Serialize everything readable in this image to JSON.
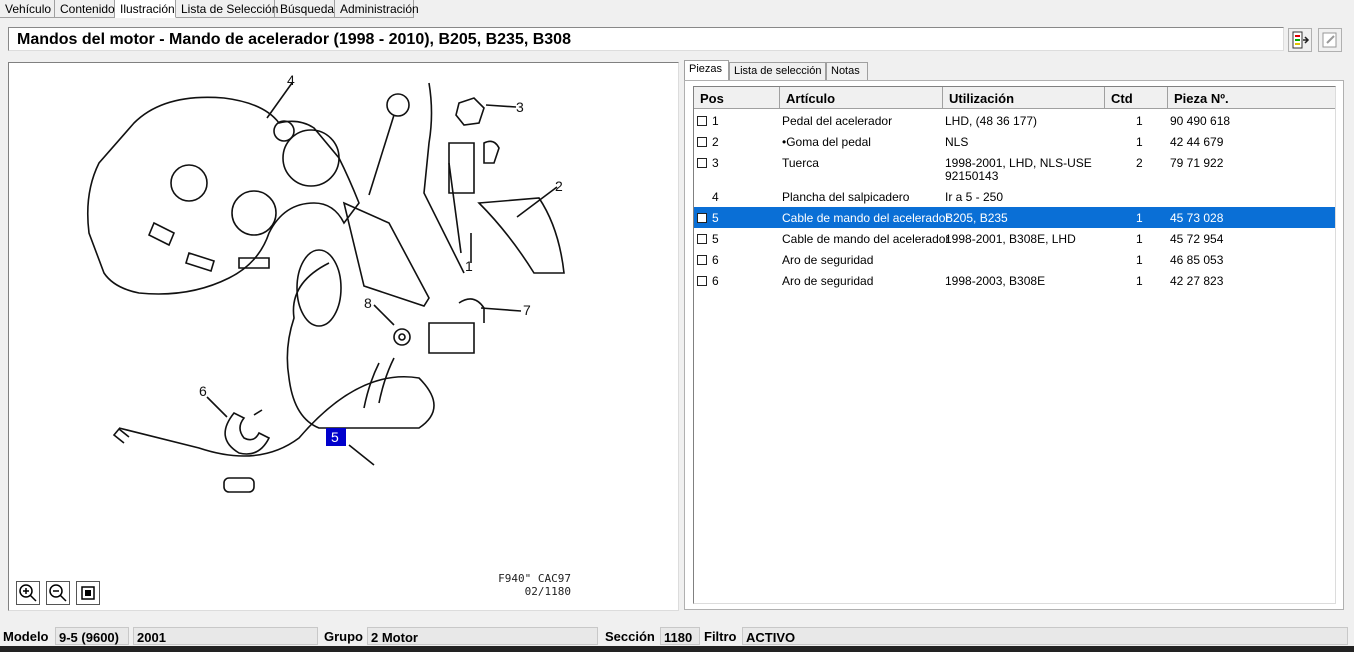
{
  "tabs": [
    "Vehículo",
    "Contenido",
    "Ilustración",
    "Lista de Selección",
    "Búsqueda",
    "Administración"
  ],
  "active_tab": "Ilustración",
  "title": "Mandos del motor - Mando de acelerador   (1998 - 2010), B205, B235, B308",
  "illustration": {
    "callouts": [
      "4",
      "3",
      "2",
      "1",
      "8",
      "7",
      "6",
      "5"
    ],
    "highlighted_callout": "5",
    "stamp_line1": "F940\" CAC97",
    "stamp_line2": "02/1180"
  },
  "right_tabs": [
    "Piezas",
    "Lista de selección",
    "Notas"
  ],
  "right_active_tab": "Piezas",
  "table": {
    "headers": [
      "Pos",
      "Artículo",
      "Utilización",
      "Ctd",
      "Pieza Nº."
    ],
    "rows": [
      {
        "check": true,
        "pos": "1",
        "articulo": "Pedal del acelerador",
        "uso": "LHD,  (48 36 177)",
        "uso2": "",
        "ctd": "1",
        "pieza": "90 490 618",
        "selected": false
      },
      {
        "check": true,
        "pos": "2",
        "articulo": "•Goma del pedal",
        "uso": "NLS",
        "uso2": "",
        "ctd": "1",
        "pieza": "42 44 679",
        "selected": false
      },
      {
        "check": true,
        "pos": "3",
        "articulo": "Tuerca",
        "uso": "1998-2001, LHD, NLS-USE",
        "uso2": "92150143",
        "ctd": "2",
        "pieza": "79 71 922",
        "selected": false
      },
      {
        "check": false,
        "pos": "4",
        "articulo": "Plancha del salpicadero",
        "uso": "Ir a 5 - 250",
        "uso2": "",
        "ctd": "",
        "pieza": "",
        "selected": false
      },
      {
        "check": true,
        "pos": "5",
        "articulo": "Cable de mando del acelerador",
        "uso": "B205, B235",
        "uso2": "",
        "ctd": "1",
        "pieza": "45 73 028",
        "selected": true
      },
      {
        "check": true,
        "pos": "5",
        "articulo": "Cable de mando del acelerador",
        "uso": "1998-2001, B308E, LHD",
        "uso2": "",
        "ctd": "1",
        "pieza": "45 72 954",
        "selected": false
      },
      {
        "check": true,
        "pos": "6",
        "articulo": "Aro de seguridad",
        "uso": "",
        "uso2": "",
        "ctd": "1",
        "pieza": "46 85 053",
        "selected": false
      },
      {
        "check": true,
        "pos": "6",
        "articulo": "Aro de seguridad",
        "uso": "1998-2003, B308E",
        "uso2": "",
        "ctd": "1",
        "pieza": "42 27 823",
        "selected": false
      }
    ]
  },
  "status": {
    "modelo_label": "Modelo",
    "modelo_value": "9-5 (9600)",
    "year_value": "2001",
    "grupo_label": "Grupo",
    "grupo_value": "2 Motor",
    "seccion_label": "Sección",
    "seccion_value": "1180",
    "filtro_label": "Filtro",
    "filtro_value": "ACTIVO"
  },
  "colors": {
    "selection": "#0a6fd6",
    "callout_highlight": "#0000cc"
  },
  "icons": [
    "exit-icon",
    "edit-icon",
    "zoom-in-icon",
    "zoom-out-icon",
    "zoom-fit-icon"
  ]
}
